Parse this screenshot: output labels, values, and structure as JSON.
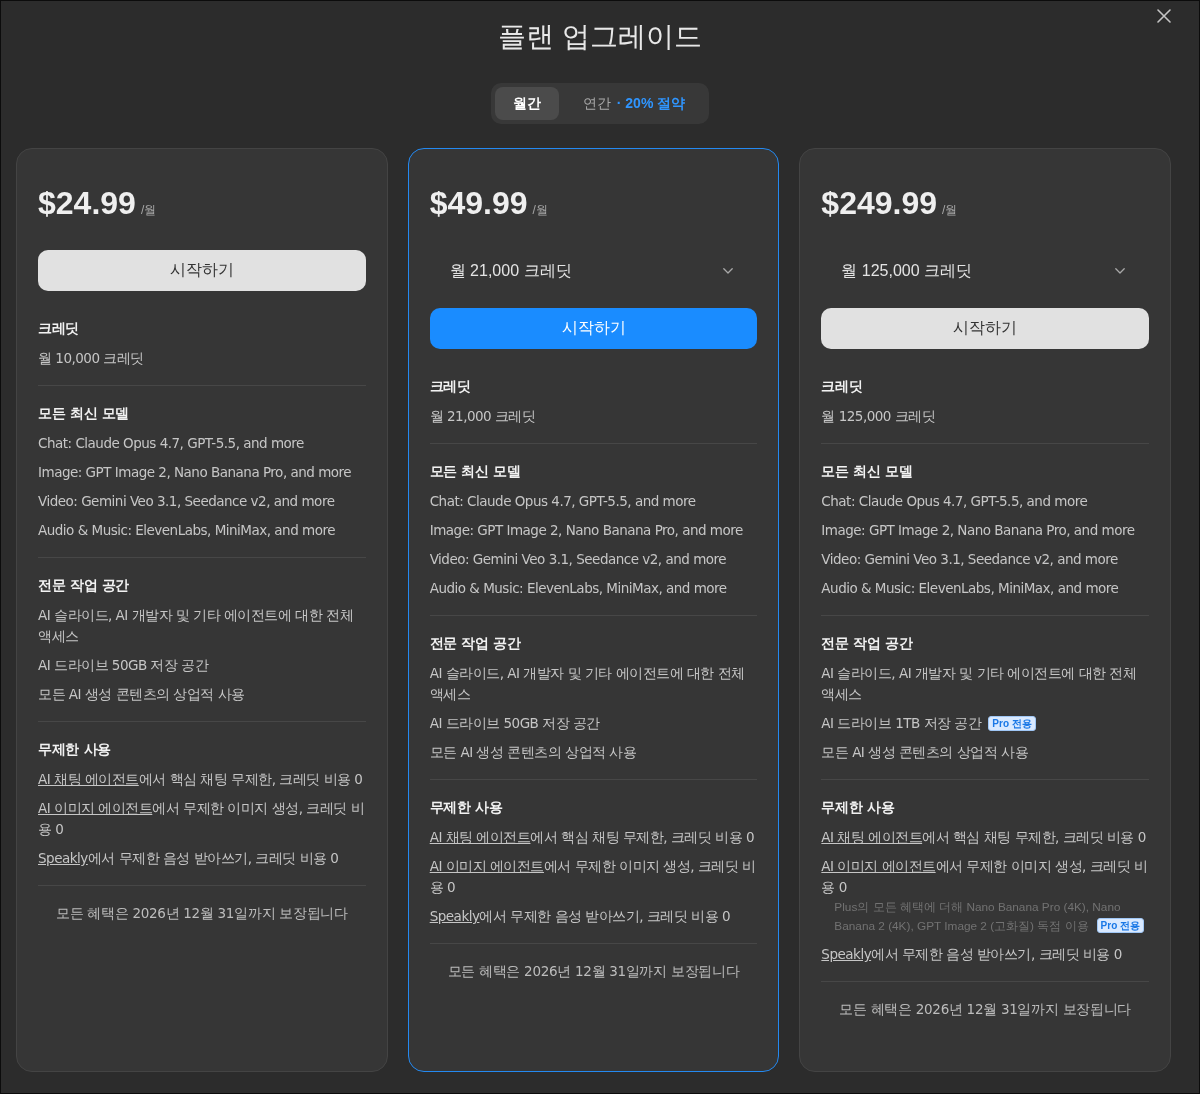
{
  "dialog": {
    "title": "플랜 업그레이드"
  },
  "billing_toggle": [
    {
      "label": "월간",
      "selected": true
    },
    {
      "label": "연간",
      "badge": "· 20% 절약",
      "selected": false
    }
  ],
  "plans": [
    {
      "price": "$24.99",
      "period": "/월",
      "highlighted": false,
      "cta": "시작하기",
      "sections": [
        {
          "heading": "크레딧",
          "items": [
            {
              "text": "월 10,000 크레딧"
            }
          ]
        },
        {
          "heading": "모든 최신 모델",
          "items": [
            {
              "text": "Chat: Claude Opus 4.7, GPT-5.5, and more"
            },
            {
              "text": "Image: GPT Image 2, Nano Banana Pro, and more"
            },
            {
              "text": "Video: Gemini Veo 3.1, Seedance v2, and more"
            },
            {
              "text": "Audio & Music: ElevenLabs, MiniMax, and more"
            }
          ]
        },
        {
          "heading": "전문 작업 공간",
          "items": [
            {
              "text": "AI 슬라이드, AI 개발자 및 기타 에이전트에 대한 전체 액세스"
            },
            {
              "text": "AI 드라이브 50GB 저장 공간"
            },
            {
              "text": "모든 AI 생성 콘텐츠의 상업적 사용"
            }
          ]
        },
        {
          "heading": "무제한 사용",
          "items": [
            {
              "link": "AI 채팅 에이전트",
              "text": "에서 핵심 채팅 무제한, 크레딧 비용 0"
            },
            {
              "link": "AI 이미지 에이전트",
              "text": "에서 무제한 이미지 생성, 크레딧 비용 0"
            },
            {
              "link": "Speakly",
              "text": "에서 무제한 음성 받아쓰기, 크레딧 비용 0"
            }
          ]
        }
      ],
      "footer": "모든 혜택은 2026년 12월 31일까지 보장됩니다"
    },
    {
      "price": "$49.99",
      "period": "/월",
      "highlighted": true,
      "credit_dropdown": {
        "value": "월 21,000 크레딧"
      },
      "cta": "시작하기",
      "sections": [
        {
          "heading": "크레딧",
          "items": [
            {
              "text": "월 21,000 크레딧"
            }
          ]
        },
        {
          "heading": "모든 최신 모델",
          "items": [
            {
              "text": "Chat: Claude Opus 4.7, GPT-5.5, and more"
            },
            {
              "text": "Image: GPT Image 2, Nano Banana Pro, and more"
            },
            {
              "text": "Video: Gemini Veo 3.1, Seedance v2, and more"
            },
            {
              "text": "Audio & Music: ElevenLabs, MiniMax, and more"
            }
          ]
        },
        {
          "heading": "전문 작업 공간",
          "items": [
            {
              "text": "AI 슬라이드, AI 개발자 및 기타 에이전트에 대한 전체 액세스"
            },
            {
              "text": "AI 드라이브 50GB 저장 공간"
            },
            {
              "text": "모든 AI 생성 콘텐츠의 상업적 사용"
            }
          ]
        },
        {
          "heading": "무제한 사용",
          "items": [
            {
              "link": "AI 채팅 에이전트",
              "text": "에서 핵심 채팅 무제한, 크레딧 비용 0"
            },
            {
              "link": "AI 이미지 에이전트",
              "text": "에서 무제한 이미지 생성, 크레딧 비용 0"
            },
            {
              "link": "Speakly",
              "text": "에서 무제한 음성 받아쓰기, 크레딧 비용 0"
            }
          ]
        }
      ],
      "footer": "모든 혜택은 2026년 12월 31일까지 보장됩니다"
    },
    {
      "price": "$249.99",
      "period": "/월",
      "highlighted": false,
      "credit_dropdown": {
        "value": "월 125,000 크레딧"
      },
      "cta": "시작하기",
      "sections": [
        {
          "heading": "크레딧",
          "items": [
            {
              "text": "월 125,000 크레딧"
            }
          ]
        },
        {
          "heading": "모든 최신 모델",
          "items": [
            {
              "text": "Chat: Claude Opus 4.7, GPT-5.5, and more"
            },
            {
              "text": "Image: GPT Image 2, Nano Banana Pro, and more"
            },
            {
              "text": "Video: Gemini Veo 3.1, Seedance v2, and more"
            },
            {
              "text": "Audio & Music: ElevenLabs, MiniMax, and more"
            }
          ]
        },
        {
          "heading": "전문 작업 공간",
          "items": [
            {
              "text": "AI 슬라이드, AI 개발자 및 기타 에이전트에 대한 전체 액세스"
            },
            {
              "text": "AI 드라이브 1TB 저장 공간",
              "badge": "Pro 전용"
            },
            {
              "text": "모든 AI 생성 콘텐츠의 상업적 사용"
            }
          ]
        },
        {
          "heading": "무제한 사용",
          "items": [
            {
              "link": "AI 채팅 에이전트",
              "text": "에서 핵심 채팅 무제한, 크레딧 비용 0"
            },
            {
              "link": "AI 이미지 에이전트",
              "text": "에서 무제한 이미지 생성, 크레딧 비용 0",
              "note": {
                "text": "Plus의 모든 혜택에 더해 Nano Banana Pro (4K), Nano Banana 2 (4K), GPT Image 2 (고화질) 독점 이용",
                "badge": "Pro 전용"
              }
            },
            {
              "link": "Speakly",
              "text": "에서 무제한 음성 받아쓰기, 크레딧 비용 0"
            }
          ]
        }
      ],
      "footer": "모든 혜택은 2026년 12월 31일까지 보장됩니다"
    }
  ]
}
